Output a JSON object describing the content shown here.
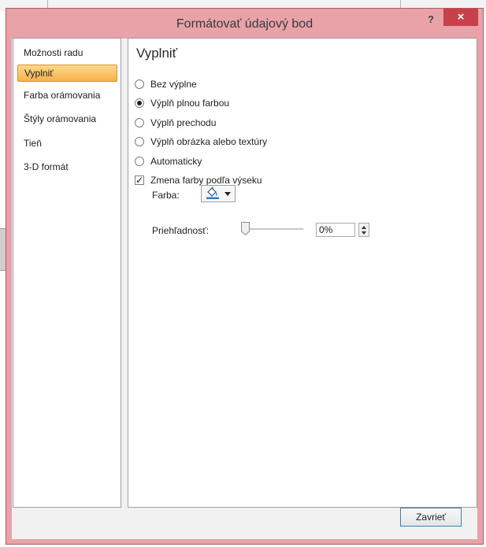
{
  "dialog": {
    "title": "Formátovať údajový bod",
    "help": "?",
    "close": "×"
  },
  "nav": {
    "items": [
      {
        "label": "Možnosti radu",
        "selected": false
      },
      {
        "label": "Vyplniť",
        "selected": true
      },
      {
        "label": "Farba orámovania",
        "selected": false
      },
      {
        "label": "Štýly orámovania",
        "selected": false
      },
      {
        "label": "Tieň",
        "selected": false
      },
      {
        "label": "3-D formát",
        "selected": false
      }
    ]
  },
  "panel": {
    "heading": "Vyplniť",
    "options": [
      {
        "label": "Bez výplne",
        "checked": false
      },
      {
        "label": "Výplň plnou farbou",
        "checked": true
      },
      {
        "label": "Výplň prechodu",
        "checked": false
      },
      {
        "label": "Výplň obrázka alebo textúry",
        "checked": false
      },
      {
        "label": "Automaticky",
        "checked": false
      }
    ],
    "vary_colors": {
      "label": "Zmena farby podľa výseku",
      "checked": true
    },
    "color": {
      "label": "Farba:",
      "icon": "paint-bucket-icon"
    },
    "transparency": {
      "label": "Priehľadnosť:",
      "value": "0%",
      "level": 0
    }
  },
  "footer": {
    "close_label": "Zavrieť"
  },
  "colors": {
    "titlebar": "#e8a2a8",
    "close": "#c7404a",
    "selection": "#f7b14a",
    "button_border": "#3c7fb1"
  }
}
